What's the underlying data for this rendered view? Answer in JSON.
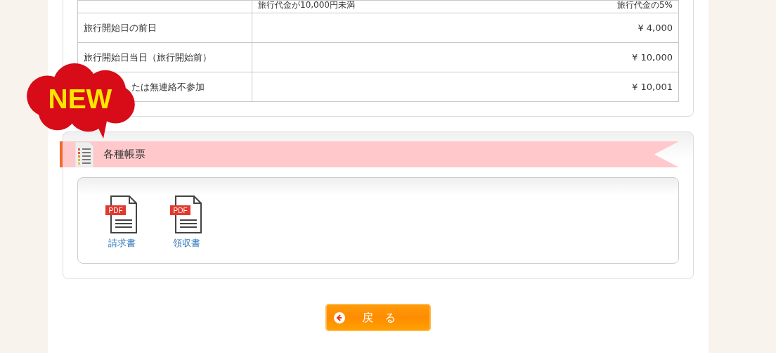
{
  "fee_table": {
    "rows": [
      {
        "label": "",
        "note": "旅行代金が10,000円未満",
        "fee": "旅行代金の5%"
      },
      {
        "label": "旅行開始日の前日",
        "fee": "¥ 4,000"
      },
      {
        "label": "旅行開始日当日（旅行開始前）",
        "fee": "¥ 10,000"
      },
      {
        "label": "たは無連絡不参加",
        "fee": "¥ 10,001"
      }
    ]
  },
  "new_badge": {
    "text": "NEW"
  },
  "documents": {
    "title": "各種帳票",
    "items": [
      {
        "label": "請求書",
        "badge": "PDF"
      },
      {
        "label": "領収書",
        "badge": "PDF"
      }
    ]
  },
  "back_button": {
    "label": "戻　る"
  }
}
